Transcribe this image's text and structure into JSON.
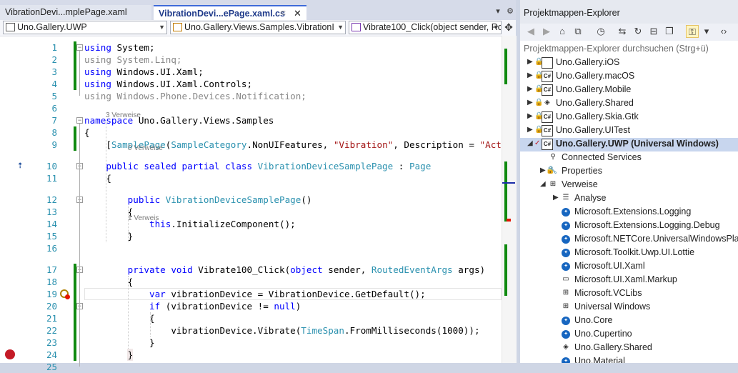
{
  "tabs": [
    {
      "label": "VibrationDevi...mplePage.xaml",
      "active": false
    },
    {
      "label": "VibrationDevi...ePage.xaml.cs",
      "active": true,
      "pin": "⊂",
      "close": "✕"
    }
  ],
  "tab_controls": {
    "dropdown": "▾",
    "settings": "⚙"
  },
  "navbar": {
    "project": "Uno.Gallery.UWP",
    "class_path": "Uno.Gallery.Views.Samples.VibrationI",
    "member": "Vibrate100_Click(object sender, Route"
  },
  "line_numbers": [
    "1",
    "2",
    "3",
    "4",
    "5",
    "6",
    "7",
    "8",
    "9",
    "10",
    "11",
    "12",
    "13",
    "14",
    "15",
    "16",
    "17",
    "18",
    "19",
    "20",
    "21",
    "22",
    "23",
    "24",
    "25"
  ],
  "codelens": {
    "class_refs": "3 Verweise",
    "ctor_refs": "0 Verweise",
    "method_refs": "1 Verweis"
  },
  "code": {
    "l1": [
      {
        "t": "using",
        "c": "kw"
      },
      {
        "t": " System;"
      }
    ],
    "l2": [
      {
        "t": "using System.Linq;",
        "c": "fa"
      }
    ],
    "l3": [
      {
        "t": "using",
        "c": "kw"
      },
      {
        "t": " Windows.UI.Xaml;"
      }
    ],
    "l4": [
      {
        "t": "using",
        "c": "kw"
      },
      {
        "t": " Windows.UI.Xaml.Controls;"
      }
    ],
    "l5": [
      {
        "t": "using Windows.Phone.Devices.Notification;",
        "c": "fa"
      }
    ],
    "l6": [],
    "l7": [
      {
        "t": "namespace",
        "c": "kw"
      },
      {
        "t": " Uno.Gallery.Views.Samples"
      }
    ],
    "l8": [
      {
        "t": "{"
      }
    ],
    "l9": [
      {
        "t": "    ["
      },
      {
        "t": "SamplePage",
        "c": "ty"
      },
      {
        "t": "("
      },
      {
        "t": "SampleCategory",
        "c": "ty"
      },
      {
        "t": ".NonUIFeatures, "
      },
      {
        "t": "\"Vibration\"",
        "c": "st"
      },
      {
        "t": ", Description = "
      },
      {
        "t": "\"Act",
        "c": "st"
      }
    ],
    "l10": [
      {
        "t": "    "
      },
      {
        "t": "public sealed partial class",
        "c": "kw"
      },
      {
        "t": " "
      },
      {
        "t": "VibrationDeviceSamplePage",
        "c": "ty"
      },
      {
        "t": " : "
      },
      {
        "t": "Page",
        "c": "ty"
      }
    ],
    "l11": [
      {
        "t": "    {"
      }
    ],
    "l12": [
      {
        "t": "        "
      },
      {
        "t": "public",
        "c": "kw"
      },
      {
        "t": " "
      },
      {
        "t": "VibrationDeviceSamplePage",
        "c": "ty"
      },
      {
        "t": "()"
      }
    ],
    "l13": [
      {
        "t": "        {"
      }
    ],
    "l14": [
      {
        "t": "            "
      },
      {
        "t": "this",
        "c": "kw"
      },
      {
        "t": ".InitializeComponent();"
      }
    ],
    "l15": [
      {
        "t": "        }"
      }
    ],
    "l16": [],
    "l17": [
      {
        "t": "        "
      },
      {
        "t": "private void",
        "c": "kw"
      },
      {
        "t": " Vibrate100_Click("
      },
      {
        "t": "object",
        "c": "kw"
      },
      {
        "t": " sender, "
      },
      {
        "t": "RoutedEventArgs",
        "c": "ty"
      },
      {
        "t": " args)"
      }
    ],
    "l18": [
      {
        "t": "        {"
      }
    ],
    "l19": [
      {
        "t": "            "
      },
      {
        "t": "var",
        "c": "kw"
      },
      {
        "t": " vibrationDevice = VibrationDevice.GetDefault();"
      }
    ],
    "l20": [
      {
        "t": "            "
      },
      {
        "t": "if",
        "c": "kw"
      },
      {
        "t": " (vibrationDevice != "
      },
      {
        "t": "null",
        "c": "kw"
      },
      {
        "t": ")"
      }
    ],
    "l21": [
      {
        "t": "            {"
      }
    ],
    "l22": [
      {
        "t": "                vibrationDevice.Vibrate("
      },
      {
        "t": "TimeSpan",
        "c": "ty"
      },
      {
        "t": ".FromMilliseconds(1000));"
      }
    ],
    "l23": [
      {
        "t": "            }"
      }
    ],
    "l24": [
      {
        "t": "        }"
      }
    ],
    "l25": []
  },
  "explorer": {
    "title": "Projektmappen-Explorer",
    "search_placeholder": "Projektmappen-Explorer durchsuchen (Strg+ü)",
    "items": [
      {
        "label": "Uno.Gallery.iOS",
        "icon": "ios-project-icon"
      },
      {
        "label": "Uno.Gallery.macOS",
        "icon": "csharp-project-icon"
      },
      {
        "label": "Uno.Gallery.Mobile",
        "icon": "csharp-project-icon"
      },
      {
        "label": "Uno.Gallery.Shared",
        "icon": "shared-project-icon"
      },
      {
        "label": "Uno.Gallery.Skia.Gtk",
        "icon": "csharp-project-icon"
      },
      {
        "label": "Uno.Gallery.UITest",
        "icon": "csharp-project-icon"
      },
      {
        "label": "Uno.Gallery.UWP (Universal Windows)",
        "icon": "csharp-project-icon"
      },
      {
        "label": "Connected Services",
        "icon": "connected-services-icon"
      },
      {
        "label": "Properties",
        "icon": "wrench-icon"
      },
      {
        "label": "Verweise",
        "icon": "references-icon"
      },
      {
        "label": "Analyse",
        "icon": "analyzer-icon"
      },
      {
        "label": "Microsoft.Extensions.Logging",
        "icon": "package-icon"
      },
      {
        "label": "Microsoft.Extensions.Logging.Debug",
        "icon": "package-icon"
      },
      {
        "label": "Microsoft.NETCore.UniversalWindowsPla",
        "icon": "package-icon"
      },
      {
        "label": "Microsoft.Toolkit.Uwp.UI.Lottie",
        "icon": "package-icon"
      },
      {
        "label": "Microsoft.UI.Xaml",
        "icon": "package-icon"
      },
      {
        "label": "Microsoft.UI.Xaml.Markup",
        "icon": "project-reference-icon"
      },
      {
        "label": "Microsoft.VCLibs",
        "icon": "sdk-reference-icon"
      },
      {
        "label": "Universal Windows",
        "icon": "sdk-reference-icon"
      },
      {
        "label": "Uno.Core",
        "icon": "package-icon"
      },
      {
        "label": "Uno.Cupertino",
        "icon": "package-icon"
      },
      {
        "label": "Uno.Gallery.Shared",
        "icon": "shared-project-icon"
      },
      {
        "label": "Uno.Material",
        "icon": "package-icon"
      }
    ]
  },
  "colors": {
    "keyword": "#0000ff",
    "type": "#2b91af",
    "string": "#a31515",
    "faded": "#888888",
    "changed_margin": "#108a10",
    "breakpoint": "#c41a26",
    "selection": "#c8d6ee"
  }
}
